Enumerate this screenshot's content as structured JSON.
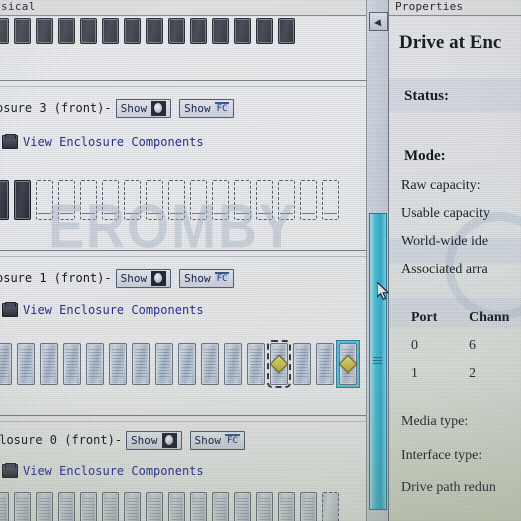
{
  "window": {
    "left_tab_label": "sical",
    "right_tab_label": "Properties"
  },
  "physical_view": {
    "top_partial_row": {
      "bay_count": 14,
      "style": "dark-populated"
    },
    "enclosures": [
      {
        "name": "osure 3  (front)-",
        "show_button_label": "Show",
        "show_icon": "hard-disk-icon",
        "show_fc_button_label": "Show",
        "fc_badge_label": "FC",
        "link_label": "View Enclosure Components",
        "link_icon": "enclosure-components-icon",
        "bays": [
          {
            "state": "populated"
          },
          {
            "state": "populated"
          },
          {
            "state": "empty"
          },
          {
            "state": "empty"
          },
          {
            "state": "empty"
          },
          {
            "state": "empty"
          },
          {
            "state": "empty"
          },
          {
            "state": "empty"
          },
          {
            "state": "empty"
          },
          {
            "state": "empty"
          },
          {
            "state": "empty"
          },
          {
            "state": "empty"
          },
          {
            "state": "empty"
          },
          {
            "state": "empty"
          },
          {
            "state": "empty"
          },
          {
            "state": "empty"
          }
        ]
      },
      {
        "name": "osure 1  (front)-",
        "show_button_label": "Show",
        "show_icon": "hard-disk-icon",
        "show_fc_button_label": "Show",
        "fc_badge_label": "FC",
        "link_label": "View Enclosure Components",
        "link_icon": "enclosure-components-icon",
        "bays": [
          {
            "state": "populated"
          },
          {
            "state": "populated"
          },
          {
            "state": "populated"
          },
          {
            "state": "populated"
          },
          {
            "state": "populated"
          },
          {
            "state": "populated"
          },
          {
            "state": "populated"
          },
          {
            "state": "populated"
          },
          {
            "state": "populated"
          },
          {
            "state": "populated"
          },
          {
            "state": "populated"
          },
          {
            "state": "populated"
          },
          {
            "state": "populated",
            "badge": "warning-diamond",
            "focus": "dashed"
          },
          {
            "state": "populated"
          },
          {
            "state": "populated"
          },
          {
            "state": "populated",
            "badge": "warning-diamond",
            "selected": true
          }
        ]
      },
      {
        "name": "closure 0  (front)-",
        "show_button_label": "Show",
        "show_icon": "hard-disk-icon",
        "show_fc_button_label": "Show",
        "fc_badge_label": "FC",
        "link_label": "View Enclosure Components",
        "link_icon": "enclosure-components-icon",
        "bays": [
          {
            "state": "populated"
          },
          {
            "state": "populated"
          },
          {
            "state": "populated"
          },
          {
            "state": "populated"
          },
          {
            "state": "populated"
          },
          {
            "state": "populated"
          },
          {
            "state": "populated"
          },
          {
            "state": "populated"
          },
          {
            "state": "populated"
          },
          {
            "state": "populated"
          },
          {
            "state": "populated"
          },
          {
            "state": "populated"
          },
          {
            "state": "populated"
          },
          {
            "state": "populated"
          },
          {
            "state": "populated"
          },
          {
            "state": "empty"
          }
        ]
      }
    ],
    "watermark": "EROMBY"
  },
  "scrollbar": {
    "up_arrow_icon": "scroll-up-arrow-icon",
    "thumb_marks_icon": "scrollbar-grip-icon",
    "cursor_icon": "mouse-pointer-icon"
  },
  "properties": {
    "title": "Drive at Enc",
    "fields": [
      {
        "label": "Status:"
      },
      {
        "label": "Mode:"
      },
      {
        "label": "Raw capacity:"
      },
      {
        "label": "Usable capacity"
      },
      {
        "label": "World-wide ide"
      },
      {
        "label": "Associated arra"
      }
    ],
    "port_table": {
      "headers": [
        "Port",
        "Chann"
      ],
      "rows": [
        [
          "0",
          "6"
        ],
        [
          "1",
          "2"
        ]
      ]
    },
    "trailing_fields": [
      {
        "label": "Media type:"
      },
      {
        "label": "Interface type:"
      },
      {
        "label": "Drive path redun"
      }
    ]
  },
  "colors": {
    "selection_cyan": "#36c3e4",
    "warning_yellow": "#cfc23a",
    "link_blue": "#1d27a8",
    "panel_bg": "#e9ecee"
  }
}
